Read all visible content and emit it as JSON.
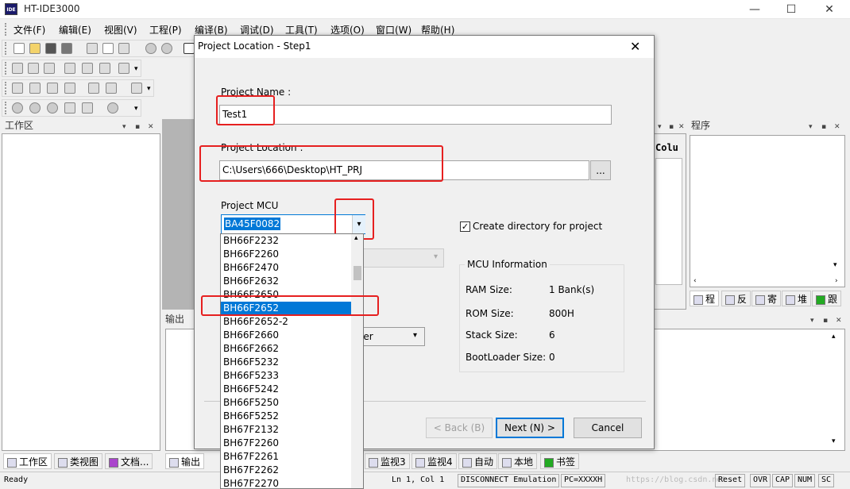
{
  "window": {
    "title": "HT-IDE3000",
    "icon_label": "IDE",
    "controls": [
      "—",
      "☐",
      "✕"
    ]
  },
  "menu": [
    "文件(F)",
    "编辑(E)",
    "视图(V)",
    "工程(P)",
    "编译(B)",
    "调试(D)",
    "工具(T)",
    "选项(O)",
    "窗口(W)",
    "帮助(H)"
  ],
  "panels": {
    "workspace_title": "工作区",
    "program_title": "程序",
    "output_title": "输出",
    "colu_label": "Colu"
  },
  "bottom_tabs_left": [
    "工作区",
    "类视图",
    "文档..."
  ],
  "bottom_tab_output": "输出",
  "bottom_tabs_mid": [
    "监视3",
    "监视4",
    "自动",
    "本地",
    "书签"
  ],
  "right_tabs": [
    "程",
    "反",
    "寄",
    "堆",
    "跟"
  ],
  "status": {
    "ready": "Ready",
    "position": "Ln 1, Col 1",
    "connection": "DISCONNECT Emulation",
    "pc": "PC=XXXXH",
    "watermark": "https://blog.csdn.net",
    "indicators": [
      "Reset",
      "OVR",
      "CAP",
      "NUM",
      "SC"
    ]
  },
  "dialog": {
    "title": "Project Location - Step1",
    "close_glyph": "✕",
    "project_name_label": "Project Name :",
    "project_name_value": "Test1",
    "project_location_label": "Project Location :",
    "project_location_value": "C:\\Users\\666\\Desktop\\HT_PRJ",
    "browse_label": "...",
    "mcu_label": "Project MCU",
    "mcu_selected": "BA45F0082",
    "create_dir_label": "Create directory for project",
    "create_dir_checked": true,
    "mcu_info": {
      "title": "MCU Information",
      "rows": [
        {
          "label": "RAM Size:",
          "value": "1 Bank(s)"
        },
        {
          "label": "ROM Size:",
          "value": "800H"
        },
        {
          "label": "Stack Size:",
          "value": "6"
        },
        {
          "label": "BootLoader Size:",
          "value": "0"
        }
      ]
    },
    "hidden_combo_text": "ler",
    "buttons": {
      "back": "< Back (B)",
      "next": "Next (N) >",
      "cancel": "Cancel"
    },
    "dropdown_items": [
      "BH66F2232",
      "BH66F2260",
      "BH66F2470",
      "BH66F2632",
      "BH66F2650",
      "BH66F2652",
      "BH66F2652-2",
      "BH66F2660",
      "BH66F2662",
      "BH66F5232",
      "BH66F5233",
      "BH66F5242",
      "BH66F5250",
      "BH66F5252",
      "BH67F2132",
      "BH67F2260",
      "BH67F2261",
      "BH67F2262",
      "BH67F2270"
    ],
    "dropdown_selected": "BH66F2652"
  },
  "colors": {
    "highlight": "#0078d7",
    "annotation_red": "#e62020"
  }
}
